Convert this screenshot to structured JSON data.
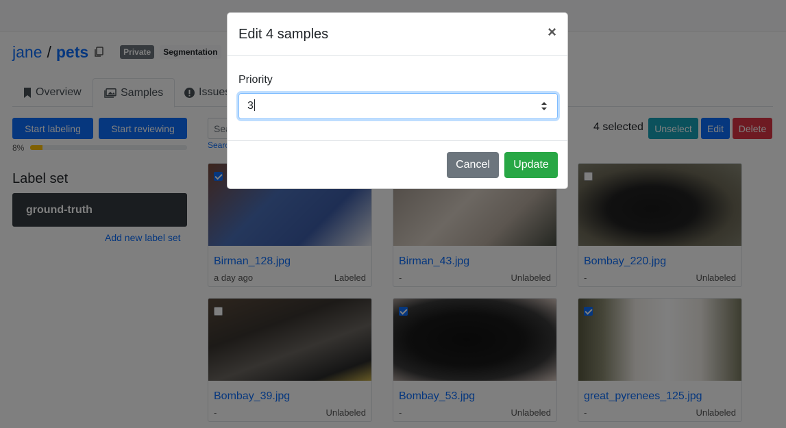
{
  "header": {
    "owner": "jane",
    "separator": "/",
    "dataset": "pets",
    "visibility_badge": "Private",
    "task_badge": "Segmentation"
  },
  "tabs": [
    {
      "label": "Overview",
      "icon": "bookmark-icon",
      "active": false
    },
    {
      "label": "Samples",
      "icon": "images-icon",
      "active": true
    },
    {
      "label": "Issues",
      "icon": "exclamation-circle-icon",
      "active": false
    }
  ],
  "sidebar": {
    "start_labeling": "Start labeling",
    "start_reviewing": "Start reviewing",
    "progress_label": "8%",
    "progress_fraction": 0.08,
    "label_set_title": "Label set",
    "label_set_item": "ground-truth",
    "add_label_set": "Add new label set"
  },
  "toolbar": {
    "search_placeholder": "Sea",
    "search_link": "Search",
    "selected_count": "4 selected",
    "unselect": "Unselect",
    "edit": "Edit",
    "delete": "Delete"
  },
  "samples": [
    {
      "name": "Birman_128.jpg",
      "meta": "a day ago",
      "status": "Labeled",
      "checked": true
    },
    {
      "name": "Birman_43.jpg",
      "meta": "-",
      "status": "Unlabeled",
      "checked": false
    },
    {
      "name": "Bombay_220.jpg",
      "meta": "-",
      "status": "Unlabeled",
      "checked": false
    },
    {
      "name": "Bombay_39.jpg",
      "meta": "-",
      "status": "Unlabeled",
      "checked": false
    },
    {
      "name": "Bombay_53.jpg",
      "meta": "-",
      "status": "Unlabeled",
      "checked": true
    },
    {
      "name": "great_pyrenees_125.jpg",
      "meta": "-",
      "status": "Unlabeled",
      "checked": true
    }
  ],
  "modal": {
    "title": "Edit 4 samples",
    "close": "×",
    "field_label": "Priority",
    "field_value": "3",
    "cancel": "Cancel",
    "update": "Update"
  },
  "colors": {
    "primary": "#0d6efd",
    "success": "#28a745",
    "secondary": "#6c757d",
    "danger": "#dc3545",
    "info": "#17a2b8",
    "warning": "#ffc107"
  }
}
